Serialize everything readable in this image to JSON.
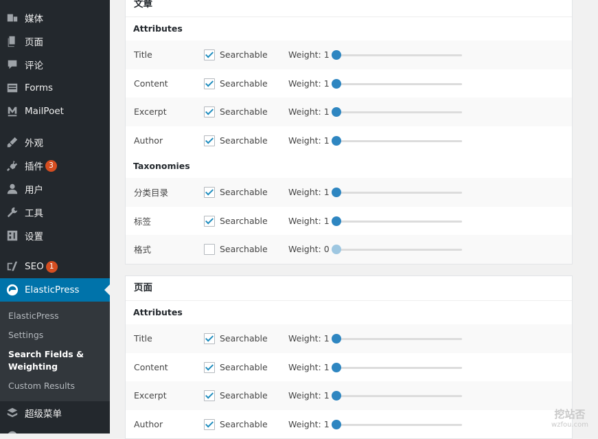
{
  "sidebar": {
    "menu": [
      {
        "key": "media",
        "icon": "media-icon",
        "label": "媒体",
        "badge": ""
      },
      {
        "key": "pages",
        "icon": "page-icon",
        "label": "页面",
        "badge": ""
      },
      {
        "key": "comments",
        "icon": "comment-icon",
        "label": "评论",
        "badge": ""
      },
      {
        "key": "forms",
        "icon": "forms-icon",
        "label": "Forms",
        "badge": ""
      },
      {
        "key": "mailpoet",
        "icon": "mailpoet-icon",
        "label": "MailPoet",
        "badge": ""
      },
      {
        "key": "appearance",
        "icon": "brush-icon",
        "label": "外观",
        "badge": ""
      },
      {
        "key": "plugins",
        "icon": "plug-icon",
        "label": "插件",
        "badge": "3"
      },
      {
        "key": "users",
        "icon": "user-icon",
        "label": "用户",
        "badge": ""
      },
      {
        "key": "tools",
        "icon": "wrench-icon",
        "label": "工具",
        "badge": ""
      },
      {
        "key": "settings",
        "icon": "settings-icon",
        "label": "设置",
        "badge": ""
      },
      {
        "key": "seo",
        "icon": "yoast-icon",
        "label": "SEO",
        "badge": "1"
      },
      {
        "key": "elasticpress",
        "icon": "elasticpress-icon",
        "label": "ElasticPress",
        "badge": ""
      },
      {
        "key": "supermenu",
        "icon": "stack-icon",
        "label": "超级菜单",
        "badge": ""
      }
    ],
    "submenu": [
      {
        "label": "ElasticPress"
      },
      {
        "label": "Settings"
      },
      {
        "label": "Search Fields & Weighting"
      },
      {
        "label": "Custom Results"
      }
    ]
  },
  "panels": [
    {
      "title": "文章",
      "groups": [
        {
          "title": "Attributes",
          "rows": [
            {
              "name": "Title",
              "checked": true,
              "searchable": "Searchable",
              "weight_label": "Weight: 1",
              "weight": 1
            },
            {
              "name": "Content",
              "checked": true,
              "searchable": "Searchable",
              "weight_label": "Weight: 1",
              "weight": 1
            },
            {
              "name": "Excerpt",
              "checked": true,
              "searchable": "Searchable",
              "weight_label": "Weight: 1",
              "weight": 1
            },
            {
              "name": "Author",
              "checked": true,
              "searchable": "Searchable",
              "weight_label": "Weight: 1",
              "weight": 1
            }
          ]
        },
        {
          "title": "Taxonomies",
          "rows": [
            {
              "name": "分类目录",
              "checked": true,
              "searchable": "Searchable",
              "weight_label": "Weight: 1",
              "weight": 1
            },
            {
              "name": "标签",
              "checked": true,
              "searchable": "Searchable",
              "weight_label": "Weight: 1",
              "weight": 1
            },
            {
              "name": "格式",
              "checked": false,
              "searchable": "Searchable",
              "weight_label": "Weight: 0",
              "weight": 0
            }
          ]
        }
      ]
    },
    {
      "title": "页面",
      "groups": [
        {
          "title": "Attributes",
          "rows": [
            {
              "name": "Title",
              "checked": true,
              "searchable": "Searchable",
              "weight_label": "Weight: 1",
              "weight": 1
            },
            {
              "name": "Content",
              "checked": true,
              "searchable": "Searchable",
              "weight_label": "Weight: 1",
              "weight": 1
            },
            {
              "name": "Excerpt",
              "checked": true,
              "searchable": "Searchable",
              "weight_label": "Weight: 1",
              "weight": 1
            },
            {
              "name": "Author",
              "checked": true,
              "searchable": "Searchable",
              "weight_label": "Weight: 1",
              "weight": 1
            }
          ]
        }
      ]
    }
  ],
  "watermark": {
    "main": "挖站否",
    "sub": "wzfou.com"
  },
  "colors": {
    "sidebar_bg": "#23282d",
    "active": "#0073aa",
    "badge": "#d54e21",
    "slider": "#2e86c1"
  }
}
